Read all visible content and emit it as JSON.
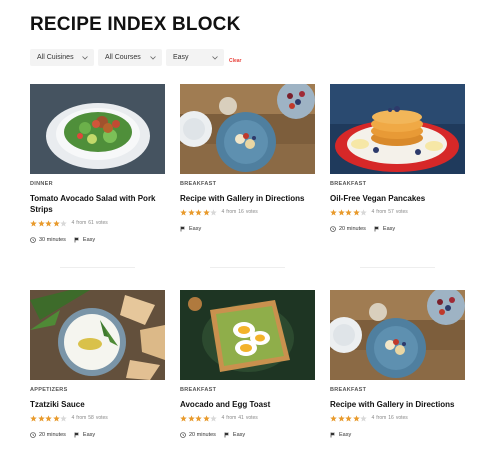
{
  "page": {
    "title": "RECIPE INDEX BLOCK"
  },
  "filters": {
    "cuisine": "All Cuisines",
    "course": "All Courses",
    "difficulty": "Easy",
    "clear_label": "Clear"
  },
  "rating_from": "from",
  "rating_votes": "votes",
  "recipes": [
    {
      "category": "DINNER",
      "title": "Tomato Avocado Salad with Pork Strips",
      "rating": 4,
      "votes": "61",
      "time": "30 minutes",
      "difficulty": "Easy"
    },
    {
      "category": "BREAKFAST",
      "title": "Recipe with Gallery in Directions",
      "rating": 4,
      "votes": "16",
      "time": "",
      "difficulty": "Easy"
    },
    {
      "category": "BREAKFAST",
      "title": "Oil-Free Vegan Pancakes",
      "rating": 4,
      "votes": "57",
      "time": "20 minutes",
      "difficulty": "Easy"
    },
    {
      "category": "APPETIZERS",
      "title": "Tzatziki Sauce",
      "rating": 4,
      "votes": "58",
      "time": "20 minutes",
      "difficulty": "Easy"
    },
    {
      "category": "BREAKFAST",
      "title": "Avocado and Egg Toast",
      "rating": 4,
      "votes": "41",
      "time": "20 minutes",
      "difficulty": "Easy"
    },
    {
      "category": "BREAKFAST",
      "title": "Recipe with Gallery in Directions",
      "rating": 4,
      "votes": "16",
      "time": "",
      "difficulty": "Easy"
    }
  ],
  "colors": {
    "star": "#e89a2c",
    "clear": "#e8423b",
    "filter_bg": "#f3f3f3"
  }
}
